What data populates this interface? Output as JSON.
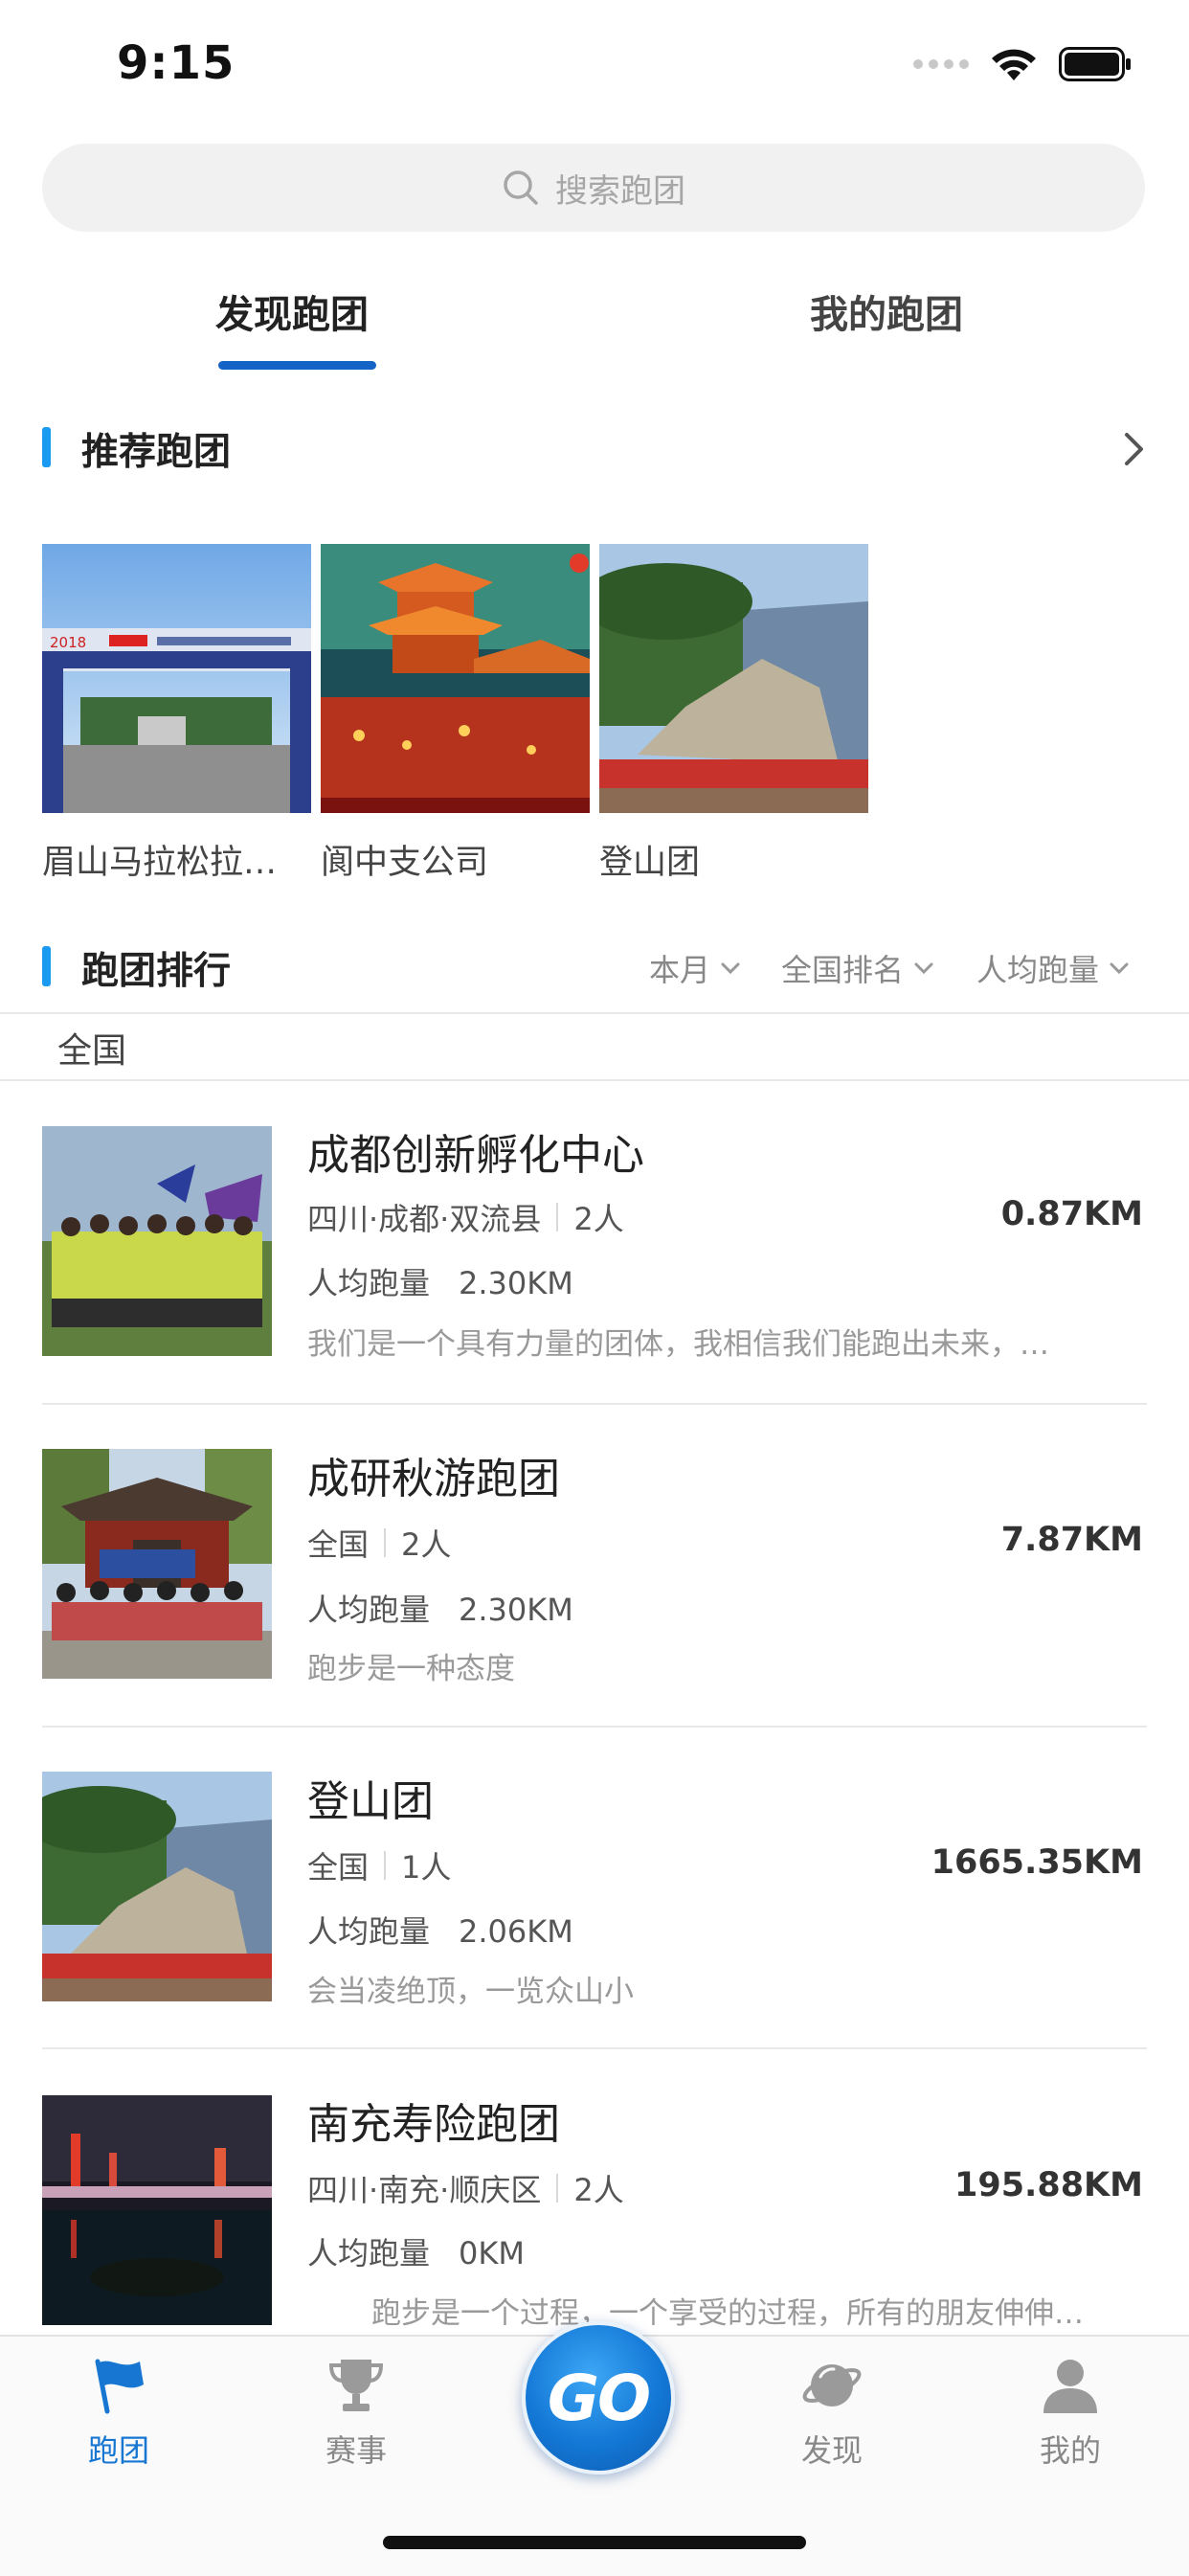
{
  "status_bar": {
    "time": "9:15"
  },
  "search": {
    "placeholder": "搜索跑团"
  },
  "tabs": [
    {
      "label": "发现跑团",
      "active": true
    },
    {
      "label": "我的跑团",
      "active": false
    }
  ],
  "recommended": {
    "title": "推荐跑团",
    "items": [
      {
        "label": "眉山马拉松拉…"
      },
      {
        "label": "阆中支公司"
      },
      {
        "label": "登山团"
      }
    ]
  },
  "ranking": {
    "title": "跑团排行",
    "filters": [
      {
        "label": "本月"
      },
      {
        "label": "全国排名"
      },
      {
        "label": "人均跑量"
      }
    ],
    "region": "全国",
    "avg_label": "人均跑量",
    "rows": [
      {
        "name": "成都创新孵化中心",
        "location": "四川·成都·双流县",
        "members": "2人",
        "distance": "0.87KM",
        "avg": "2.30KM",
        "desc": "我们是一个具有力量的团体，我相信我们能跑出未来，…"
      },
      {
        "name": "成研秋游跑团",
        "location": "全国",
        "members": "2人",
        "distance": "7.87KM",
        "avg": "2.30KM",
        "desc": "跑步是一种态度"
      },
      {
        "name": "登山团",
        "location": "全国",
        "members": "1人",
        "distance": "1665.35KM",
        "avg": "2.06KM",
        "desc": "会当凌绝顶，一览众山小"
      },
      {
        "name": "南充寿险跑团",
        "location": "四川·南充·顺庆区",
        "members": "2人",
        "distance": "195.88KM",
        "avg": "0KM",
        "desc": "跑步是一个过程，一个享受的过程，所有的朋友伸伸…"
      }
    ]
  },
  "tabbar": {
    "items": [
      {
        "label": "跑团",
        "icon": "flag-icon",
        "active": true
      },
      {
        "label": "赛事",
        "icon": "trophy-icon",
        "active": false
      },
      {
        "label": "发现",
        "icon": "planet-icon",
        "active": false
      },
      {
        "label": "我的",
        "icon": "person-icon",
        "active": false
      }
    ],
    "go_label": "GO"
  },
  "colors": {
    "accent": "#1463c6",
    "section_bar": "#1a9af0",
    "tab_active": "#1676d2"
  }
}
